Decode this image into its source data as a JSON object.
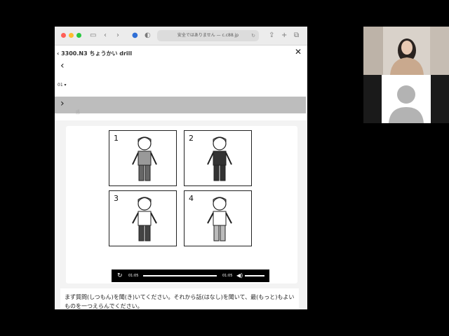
{
  "browser": {
    "url": "安全ではありません — c.c88.jp",
    "icons": {
      "sidebar": "sidebar-icon",
      "back": "chevron-left-icon",
      "forward": "chevron-right-icon",
      "share": "share-icon",
      "new_tab": "plus-icon",
      "tabs": "tabs-icon"
    },
    "traffic_colors": [
      "#ff5f57",
      "#febc2e",
      "#28c840"
    ]
  },
  "app": {
    "title": "3300.N3 ちょうかい drill",
    "track_selector": "01 ▾"
  },
  "player": {
    "current_time": "01:05",
    "duration": "01:05",
    "progress": 1.0
  },
  "question": {
    "panels": [
      {
        "number": "1"
      },
      {
        "number": "2"
      },
      {
        "number": "3"
      },
      {
        "number": "4"
      }
    ],
    "instruction": "まず質問(しつもん)を聞(き)いてください。それから話(はなし)を聞いて、最(もっと)もよいものを一つえらんでください。"
  }
}
